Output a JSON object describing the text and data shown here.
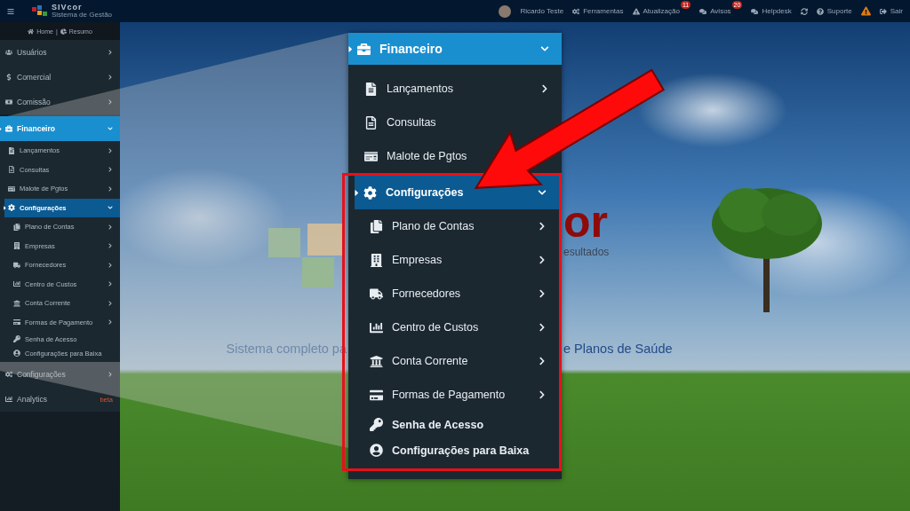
{
  "topbar": {
    "app_name": "SIVcor",
    "app_subtitle": "Sistema de Gestão",
    "user": "Ricardo Teste",
    "actions": [
      {
        "label": "Ferramentas"
      },
      {
        "label": "Atualização",
        "badge": "11"
      },
      {
        "label": "Avisos",
        "badge": "20"
      },
      {
        "label": "Helpdesk"
      },
      {
        "label": "Suporte"
      },
      {
        "label": "Sair"
      }
    ]
  },
  "sidebar": {
    "home": "Home",
    "separator": "|",
    "summary": "Resumo",
    "items": [
      {
        "label": "Usuários",
        "selected": false,
        "expanded": false,
        "chevron": true
      },
      {
        "label": "Comercial",
        "selected": false,
        "expanded": false,
        "chevron": true
      },
      {
        "label": "Comissão",
        "selected": false,
        "expanded": false,
        "chevron": true
      },
      {
        "label": "Financeiro",
        "selected": true,
        "expanded": true,
        "chevron": true,
        "children": [
          {
            "label": "Lançamentos",
            "selected": false,
            "expanded": false,
            "chevron": true
          },
          {
            "label": "Consultas",
            "selected": false,
            "expanded": false,
            "chevron": true
          },
          {
            "label": "Malote de Pgtos",
            "selected": false,
            "expanded": false,
            "chevron": true
          },
          {
            "label": "Configurações",
            "selected": true,
            "expanded": true,
            "chevron": true,
            "children": [
              {
                "label": "Plano de Contas",
                "selected": false,
                "expanded": false,
                "chevron": true
              },
              {
                "label": "Empresas",
                "selected": false,
                "expanded": false,
                "chevron": true
              },
              {
                "label": "Fornecedores",
                "selected": false,
                "expanded": false,
                "chevron": true
              },
              {
                "label": "Centro de Custos",
                "selected": false,
                "expanded": false,
                "chevron": true
              },
              {
                "label": "Conta Corrente",
                "selected": false,
                "expanded": false,
                "chevron": true
              },
              {
                "label": "Formas de Pagamento",
                "selected": false,
                "expanded": false,
                "chevron": true
              },
              {
                "label": "Senha de Acesso",
                "selected": false,
                "expanded": false,
                "chevron": false
              },
              {
                "label": "Configurações para Baixa",
                "selected": false,
                "expanded": false,
                "chevron": false
              }
            ]
          }
        ]
      },
      {
        "label": "Configurações",
        "selected": false,
        "expanded": false,
        "chevron": true
      },
      {
        "label": "Analytics",
        "badge": "beta",
        "selected": false,
        "expanded": false,
        "chevron": false
      }
    ]
  },
  "background": {
    "logo_text": "or",
    "tagline": "esultados",
    "slogan_left": "Sistema completo pa",
    "slogan_right": "e Planos de Saúde"
  },
  "callout": {
    "label": "Financeiro",
    "selected": true,
    "expanded": true,
    "chevron": true,
    "children": [
      {
        "label": "Lançamentos",
        "selected": false,
        "expanded": false,
        "chevron": true
      },
      {
        "label": "Consultas",
        "selected": false,
        "expanded": false,
        "chevron": false
      },
      {
        "label": "Malote de Pgtos",
        "selected": false,
        "expanded": false
      },
      {
        "label": "Configurações",
        "selected": true,
        "expanded": true,
        "chevron": true,
        "highlighted": true,
        "children": [
          {
            "label": "Plano de Contas",
            "selected": false,
            "expanded": false,
            "chevron": true
          },
          {
            "label": "Empresas",
            "selected": false,
            "expanded": false,
            "chevron": true
          },
          {
            "label": "Fornecedores",
            "selected": false,
            "expanded": false,
            "chevron": true
          },
          {
            "label": "Centro de Custos",
            "selected": false,
            "expanded": false,
            "chevron": true
          },
          {
            "label": "Conta Corrente",
            "selected": false,
            "expanded": false,
            "chevron": true
          },
          {
            "label": "Formas de Pagamento",
            "selected": false,
            "expanded": false,
            "chevron": true
          },
          {
            "label": "Senha de Acesso",
            "selected": false,
            "expanded": false,
            "chevron": false
          },
          {
            "label": "Configurações para Baixa",
            "selected": false,
            "expanded": false,
            "chevron": false
          }
        ]
      }
    ]
  }
}
